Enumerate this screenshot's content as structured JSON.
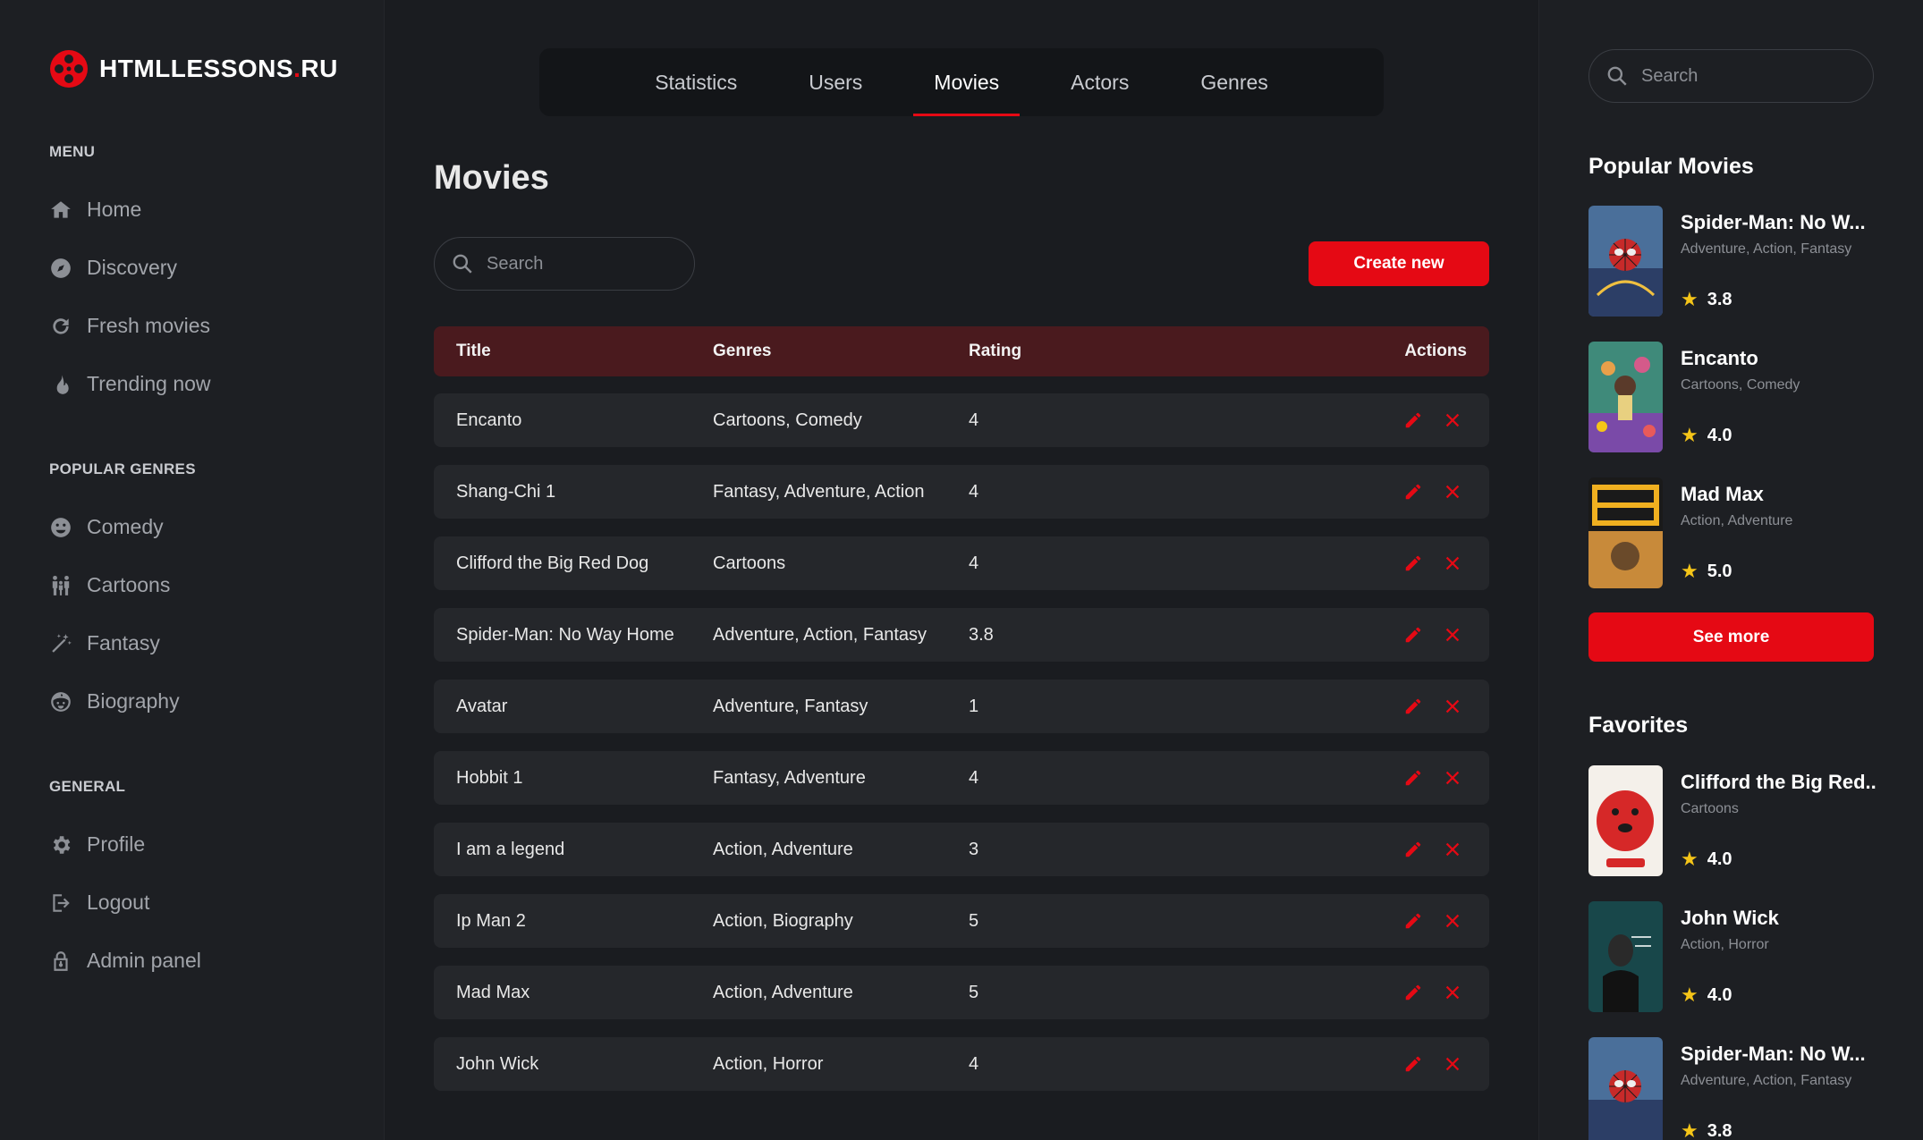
{
  "brand": {
    "name_main": "HTMLLESSONS",
    "name_dot": ".",
    "name_tld": "RU",
    "accent": "#e50914"
  },
  "sidebar": {
    "menu_heading": "MENU",
    "menu": [
      {
        "label": "Home",
        "icon": "home-icon"
      },
      {
        "label": "Discovery",
        "icon": "compass-icon"
      },
      {
        "label": "Fresh movies",
        "icon": "refresh-icon"
      },
      {
        "label": "Trending now",
        "icon": "flame-icon"
      }
    ],
    "genres_heading": "POPULAR GENRES",
    "genres": [
      {
        "label": "Comedy",
        "icon": "smile-icon"
      },
      {
        "label": "Cartoons",
        "icon": "family-icon"
      },
      {
        "label": "Fantasy",
        "icon": "magic-wand-icon"
      },
      {
        "label": "Biography",
        "icon": "baby-face-icon"
      }
    ],
    "general_heading": "GENERAL",
    "general": [
      {
        "label": "Profile",
        "icon": "gear-icon"
      },
      {
        "label": "Logout",
        "icon": "logout-icon"
      },
      {
        "label": "Admin panel",
        "icon": "lock-icon"
      }
    ]
  },
  "tabs": [
    {
      "label": "Statistics"
    },
    {
      "label": "Users"
    },
    {
      "label": "Movies",
      "active": true
    },
    {
      "label": "Actors"
    },
    {
      "label": "Genres"
    }
  ],
  "main": {
    "title": "Movies",
    "search_placeholder": "Search",
    "create_label": "Create new",
    "columns": {
      "title": "Title",
      "genres": "Genres",
      "rating": "Rating",
      "actions": "Actions"
    },
    "rows": [
      {
        "title": "Encanto",
        "genres": "Cartoons, Comedy",
        "rating": "4"
      },
      {
        "title": "Shang-Chi 1",
        "genres": "Fantasy, Adventure, Action",
        "rating": "4"
      },
      {
        "title": "Clifford the Big Red Dog",
        "genres": "Cartoons",
        "rating": "4"
      },
      {
        "title": "Spider-Man: No Way Home",
        "genres": "Adventure, Action, Fantasy",
        "rating": "3.8"
      },
      {
        "title": "Avatar",
        "genres": "Adventure, Fantasy",
        "rating": "1"
      },
      {
        "title": "Hobbit 1",
        "genres": "Fantasy, Adventure",
        "rating": "4"
      },
      {
        "title": "I am a legend",
        "genres": "Action, Adventure",
        "rating": "3"
      },
      {
        "title": "Ip Man 2",
        "genres": "Action, Biography",
        "rating": "5"
      },
      {
        "title": "Mad Max",
        "genres": "Action, Adventure",
        "rating": "5"
      },
      {
        "title": "John Wick",
        "genres": "Action, Horror",
        "rating": "4"
      }
    ]
  },
  "right": {
    "search_placeholder": "Search",
    "popular_heading": "Popular Movies",
    "popular": [
      {
        "title": "Spider-Man: No W...",
        "genres": "Adventure, Action, Fantasy",
        "rating": "3.8",
        "poster": "spiderman"
      },
      {
        "title": "Encanto",
        "genres": "Cartoons, Comedy",
        "rating": "4.0",
        "poster": "encanto"
      },
      {
        "title": "Mad Max",
        "genres": "Action, Adventure",
        "rating": "5.0",
        "poster": "madmax"
      }
    ],
    "see_more_label": "See more",
    "favorites_heading": "Favorites",
    "favorites": [
      {
        "title": "Clifford the Big Red...",
        "genres": "Cartoons",
        "rating": "4.0",
        "poster": "clifford"
      },
      {
        "title": "John Wick",
        "genres": "Action, Horror",
        "rating": "4.0",
        "poster": "johnwick"
      },
      {
        "title": "Spider-Man: No W...",
        "genres": "Adventure, Action, Fantasy",
        "rating": "3.8",
        "poster": "spiderman"
      }
    ]
  }
}
